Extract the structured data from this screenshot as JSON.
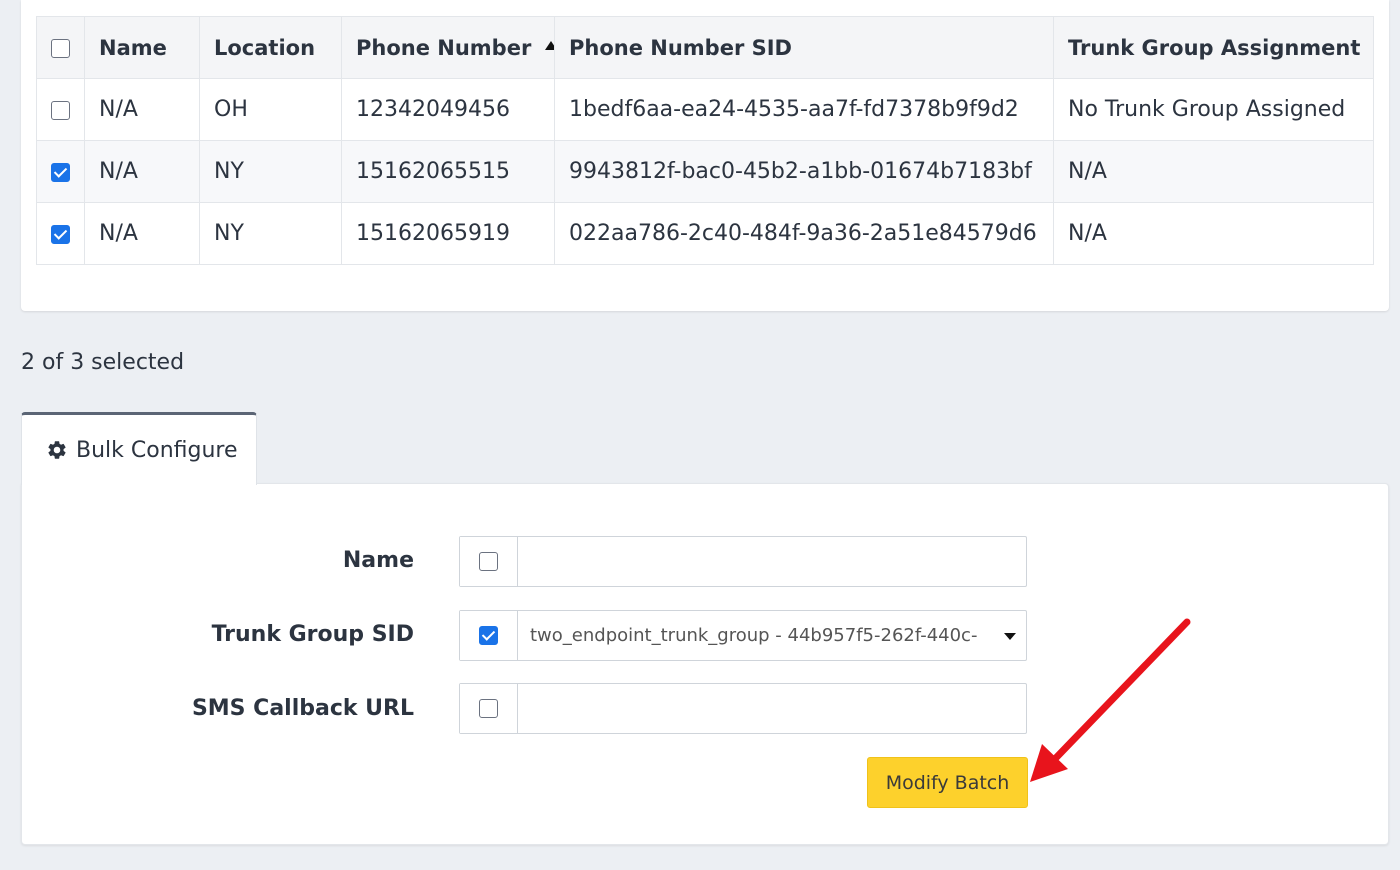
{
  "table": {
    "columns": [
      "Name",
      "Location",
      "Phone Number",
      "Phone Number SID",
      "Trunk Group Assignment"
    ],
    "sorted_column": "Phone Number",
    "header_checkbox_checked": false,
    "rows": [
      {
        "checked": false,
        "name": "N/A",
        "location": "OH",
        "phone": "12342049456",
        "sid": "1bedf6aa-ea24-4535-aa7f-fd7378b9f9d2",
        "trunk": "No Trunk Group Assigned"
      },
      {
        "checked": true,
        "name": "N/A",
        "location": "NY",
        "phone": "15162065515",
        "sid": "9943812f-bac0-45b2-a1bb-01674b7183bf",
        "trunk": "N/A"
      },
      {
        "checked": true,
        "name": "N/A",
        "location": "NY",
        "phone": "15162065919",
        "sid": "022aa786-2c40-484f-9a36-2a51e84579d6",
        "trunk": "N/A"
      }
    ]
  },
  "selection_status": "2 of 3 selected",
  "tab": {
    "label": "Bulk Configure",
    "icon": "gear-icon"
  },
  "form": {
    "name_label": "Name",
    "name_enabled": false,
    "name_value": "",
    "trunk_label": "Trunk Group SID",
    "trunk_enabled": true,
    "trunk_value": "two_endpoint_trunk_group - 44b957f5-262f-440c-",
    "sms_label": "SMS Callback URL",
    "sms_enabled": false,
    "sms_value": ""
  },
  "actions": {
    "modify_label": "Modify Batch"
  },
  "colors": {
    "accent_button": "#fdd12c",
    "checkbox_checked": "#1a73e8",
    "annotation_arrow": "#e8141c"
  }
}
